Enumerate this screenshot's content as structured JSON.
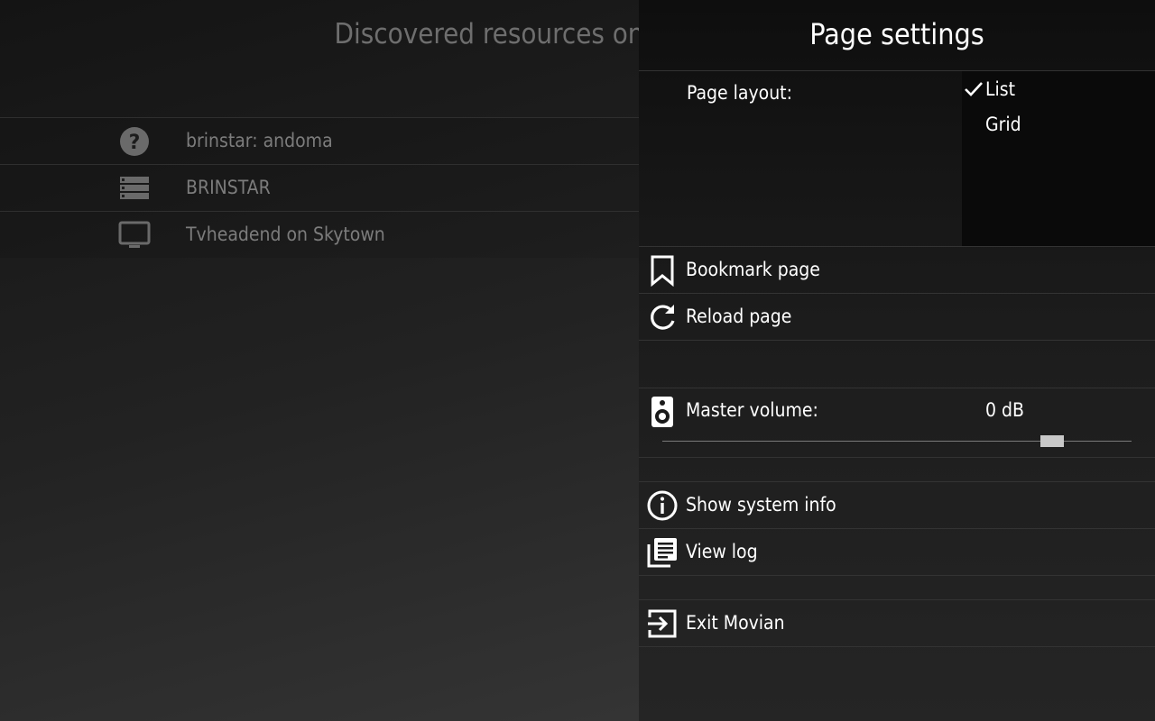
{
  "background": {
    "title": "Discovered resources on local network",
    "resources": [
      {
        "label": "brinstar: andoma",
        "icon": "question-circle-icon"
      },
      {
        "label": "BRINSTAR",
        "icon": "server-icon"
      },
      {
        "label": "Tvheadend on Skytown",
        "icon": "tv-icon"
      }
    ]
  },
  "panel": {
    "title": "Page settings",
    "page_layout": {
      "label": "Page layout:",
      "options": [
        {
          "label": "List",
          "selected": true
        },
        {
          "label": "Grid",
          "selected": false
        }
      ]
    },
    "bookmark_label": "Bookmark page",
    "reload_label": "Reload page",
    "volume": {
      "label": "Master volume:",
      "value_text": "0 dB",
      "level": 0.83
    },
    "system_info_label": "Show system info",
    "view_log_label": "View log",
    "exit_label": "Exit Movian"
  },
  "colors": {
    "dim_text": "#7c7c7c",
    "panel_bg": "#151515",
    "thumb": "#c8c8c8"
  }
}
